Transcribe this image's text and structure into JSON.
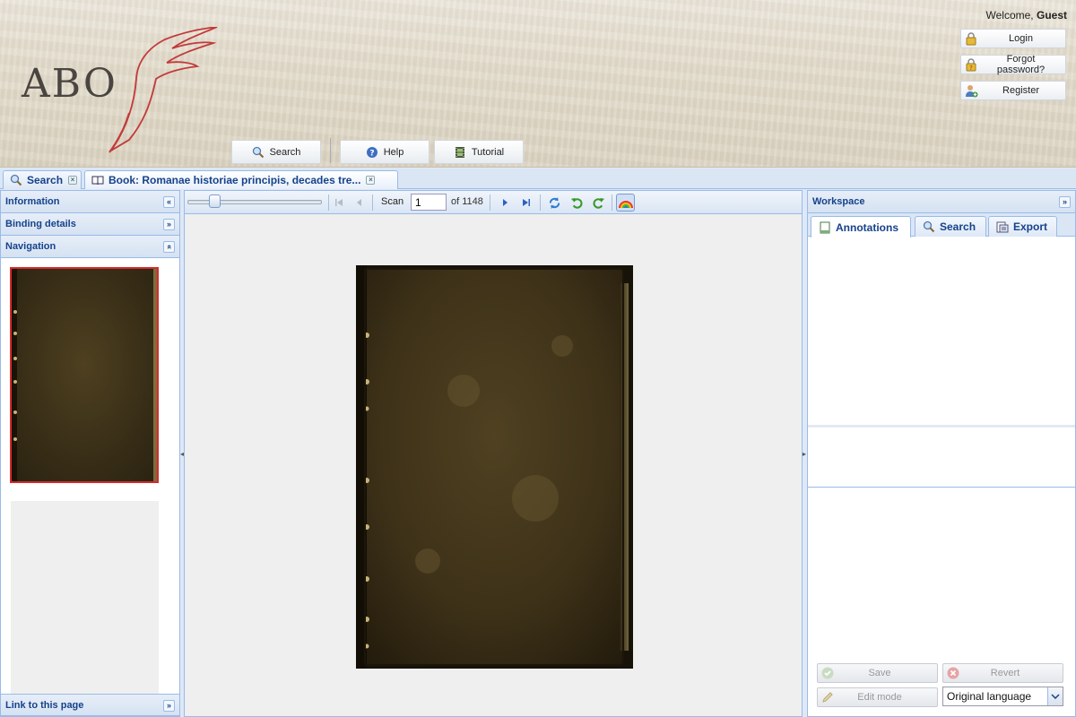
{
  "header": {
    "logo_text": "ABO",
    "welcome_prefix": "Welcome,",
    "welcome_user": "Guest",
    "account": {
      "login": "Login",
      "forgot": "Forgot password?",
      "register": "Register"
    },
    "nav": {
      "search": "Search",
      "help": "Help",
      "tutorial": "Tutorial"
    }
  },
  "tabs": [
    {
      "label": "Search",
      "icon": "magnifier-icon"
    },
    {
      "label": "Book: Romanae historiae principis, decades tre...",
      "icon": "book-icon",
      "active": true
    }
  ],
  "left_panel": {
    "information": "Information",
    "binding_details": "Binding details",
    "navigation": "Navigation",
    "link_to_page": "Link to this page"
  },
  "viewer": {
    "scan_label": "Scan",
    "scan_value": "1",
    "scan_total": "of 1148"
  },
  "workspace": {
    "title": "Workspace",
    "tabs": [
      "Annotations",
      "Search",
      "Export"
    ],
    "save": "Save",
    "revert": "Revert",
    "edit_mode": "Edit mode",
    "language": "Original language"
  },
  "colors": {
    "panel_header_text": "#15428b",
    "border": "#99bbe8",
    "selected_thumb": "#d52b2b"
  }
}
